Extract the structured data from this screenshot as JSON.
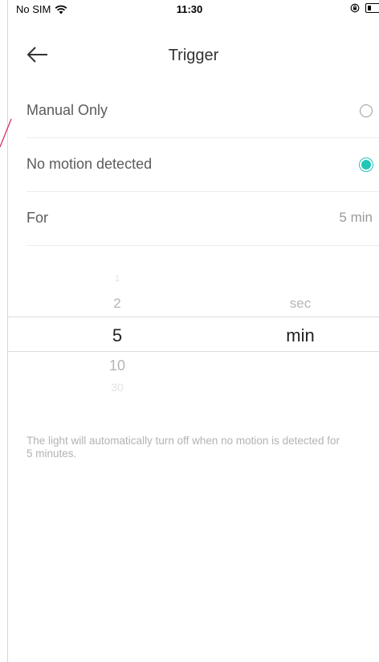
{
  "status_bar": {
    "carrier": "No SIM",
    "time": "11:30",
    "wifi_icon": "wifi-icon",
    "lock_icon": "orientation-lock-icon",
    "battery_icon": "battery-icon"
  },
  "header": {
    "back_icon": "arrow-left-icon",
    "title": "Trigger"
  },
  "options": [
    {
      "label": "Manual Only",
      "selected": false
    },
    {
      "label": "No motion detected",
      "selected": true
    }
  ],
  "duration_row": {
    "label": "For",
    "value": "5 min"
  },
  "picker": {
    "numbers": [
      "1",
      "2",
      "5",
      "10",
      "30"
    ],
    "units": [
      "sec",
      "min"
    ],
    "selected_number": "5",
    "selected_unit": "min"
  },
  "hint": "The light will automatically turn off when no motion is detected for 5 minutes.",
  "colors": {
    "accent": "#20c6b6",
    "text": "#333333",
    "muted": "#9a9a9a"
  }
}
